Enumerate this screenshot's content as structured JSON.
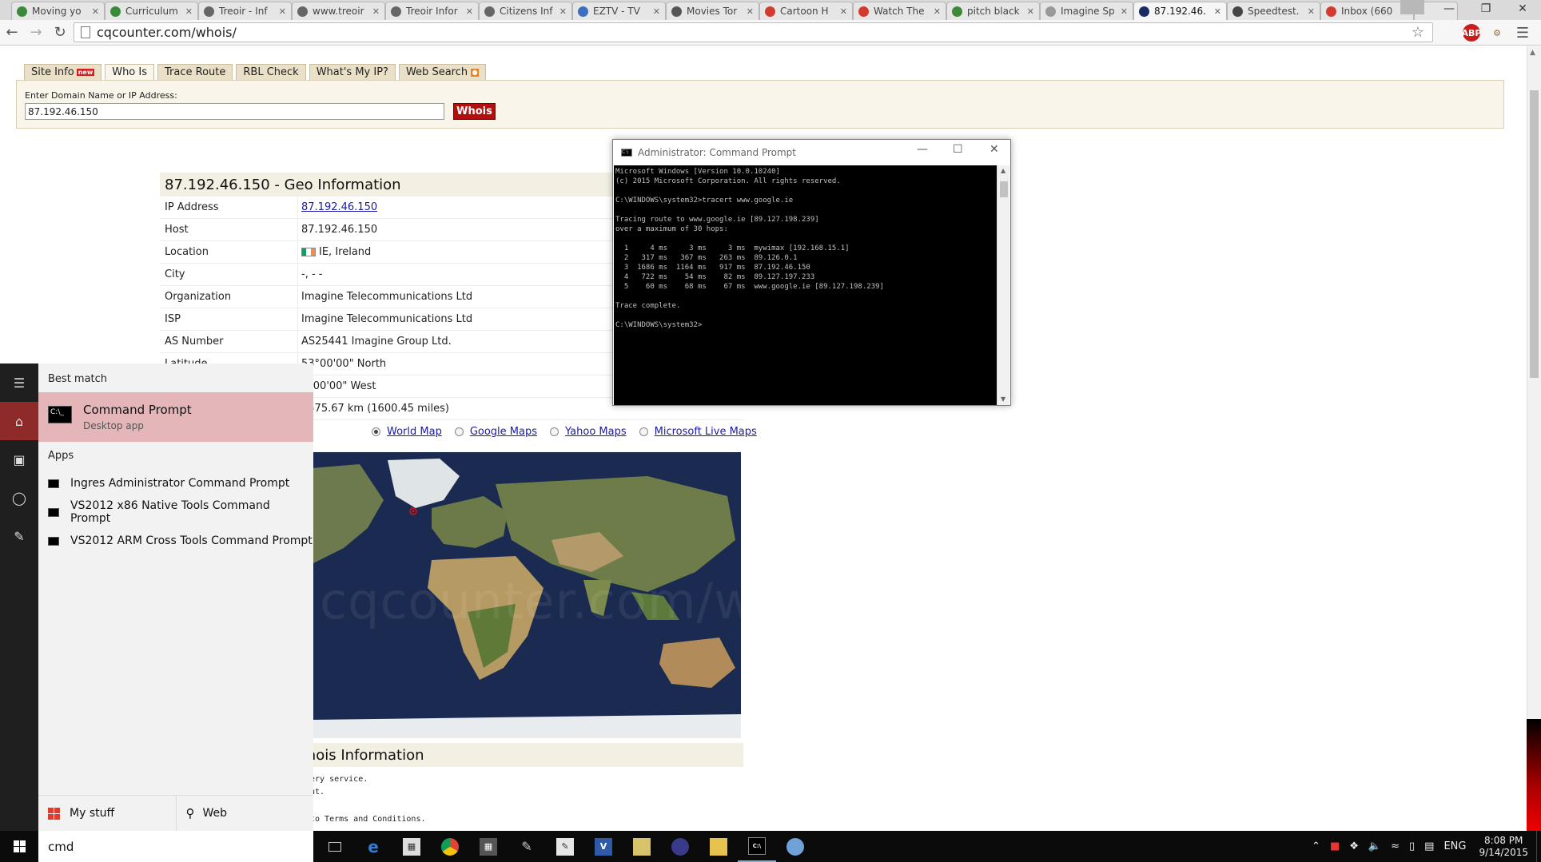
{
  "browser": {
    "tabs": [
      {
        "title": "Moving yo",
        "color": "#3b8a3a"
      },
      {
        "title": "Curriculum",
        "color": "#3b8a3a"
      },
      {
        "title": "Treoir - Inf",
        "color": "#666"
      },
      {
        "title": "www.treoir",
        "color": "#666"
      },
      {
        "title": "Treoir Infor",
        "color": "#666"
      },
      {
        "title": "Citizens Inf",
        "color": "#666"
      },
      {
        "title": "EZTV - TV",
        "color": "#3a6fbf"
      },
      {
        "title": "Movies Tor",
        "color": "#555"
      },
      {
        "title": "Cartoon H",
        "color": "#d23b2e"
      },
      {
        "title": "Watch The",
        "color": "#d23b2e"
      },
      {
        "title": "pitch black",
        "color": "#3b8a3a"
      },
      {
        "title": "Imagine Sp",
        "color": "#999"
      },
      {
        "title": "87.192.46.",
        "color": "#1a2a66",
        "active": true
      },
      {
        "title": "Speedtest.",
        "color": "#444"
      },
      {
        "title": "Inbox (660",
        "color": "#d23b2e"
      }
    ],
    "url": "cqcounter.com/whois/"
  },
  "site": {
    "tabs": [
      "Site Info",
      "Who Is",
      "Trace Route",
      "RBL Check",
      "What's My IP?",
      "Web Search"
    ],
    "new_badge": "new",
    "search_label": "Enter Domain Name or IP Address:",
    "search_value": "87.192.46.150",
    "whois_button": "Whois"
  },
  "geo": {
    "title": "87.192.46.150 - Geo Information",
    "rows": [
      {
        "k": "IP Address",
        "v": "87.192.46.150",
        "link": true
      },
      {
        "k": "Host",
        "v": "87.192.46.150"
      },
      {
        "k": "Location",
        "v": "IE, Ireland",
        "flag": true
      },
      {
        "k": "City",
        "v": "-, - -"
      },
      {
        "k": "Organization",
        "v": "Imagine Telecommunications Ltd"
      },
      {
        "k": "ISP",
        "v": "Imagine Telecommunications Ltd"
      },
      {
        "k": "AS Number",
        "v": "AS25441 Imagine Group Ltd."
      },
      {
        "k": "Latitude",
        "v": "53°00'00\" North"
      },
      {
        "k": "Longitude",
        "v": "8°00'00\" West"
      },
      {
        "k": "Distance",
        "v": "2575.67 km (1600.45 miles)"
      }
    ],
    "map_options": [
      "World Map",
      "Google Maps",
      "Yahoo Maps",
      "Microsoft Live Maps"
    ],
    "watermark": "cqcounter.com/whois",
    "whois_title": "Whois Information",
    "whois_lines": [
      "ery service.",
      "ut.",
      "to Terms and Conditions."
    ]
  },
  "cmd": {
    "title": "Administrator: Command Prompt",
    "lines": [
      "Microsoft Windows [Version 10.0.10240]",
      "(c) 2015 Microsoft Corporation. All rights reserved.",
      "",
      "C:\\WINDOWS\\system32>tracert www.google.ie",
      "",
      "Tracing route to www.google.ie [89.127.198.239]",
      "over a maximum of 30 hops:",
      "",
      "  1     4 ms     3 ms     3 ms  mywimax [192.168.15.1]",
      "  2   317 ms   367 ms   263 ms  89.126.0.1",
      "  3  1686 ms  1164 ms   917 ms  87.192.46.150",
      "  4   722 ms    54 ms    82 ms  89.127.197.233",
      "  5    60 ms    68 ms    67 ms  www.google.ie [89.127.198.239]",
      "",
      "Trace complete.",
      "",
      "C:\\WINDOWS\\system32>"
    ]
  },
  "start_menu": {
    "best_match_label": "Best match",
    "best_match_name": "Command Prompt",
    "best_match_sub": "Desktop app",
    "apps_label": "Apps",
    "apps": [
      "Ingres Administrator Command Prompt",
      "VS2012 x86 Native Tools Command Prompt",
      "VS2012 ARM Cross Tools Command Prompt"
    ],
    "footer_left": "My stuff",
    "footer_right": "Web",
    "search_text": "cmd"
  },
  "taskbar": {
    "lang": "ENG",
    "time": "8:08 PM",
    "date": "9/14/2015"
  }
}
